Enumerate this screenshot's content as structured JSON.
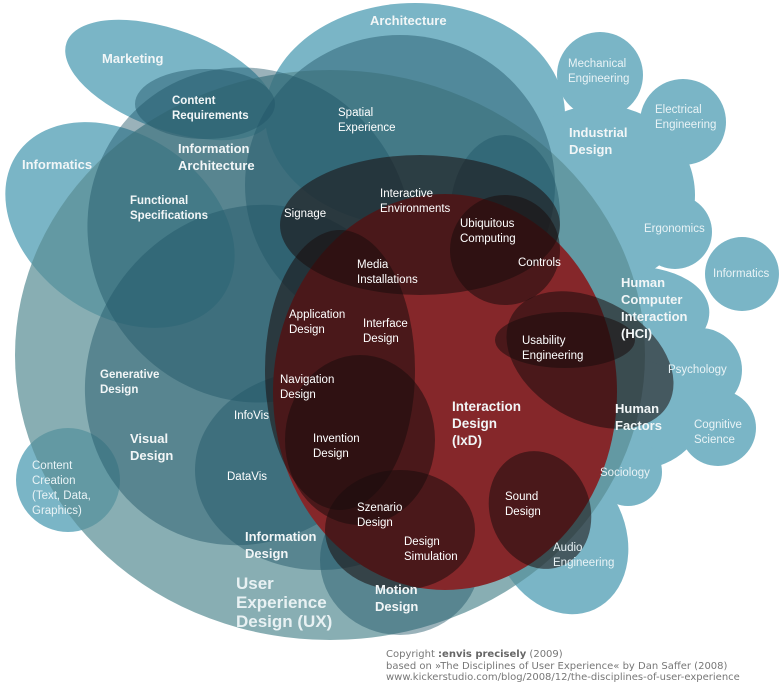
{
  "title": "The Disciplines of User Experience",
  "colors": {
    "light_teal": "#7ab5c6",
    "mid_teal": "#3f7f8e",
    "dark_teal": "#1f5566",
    "ux_gray_teal": "#8fb2b3",
    "ixd_red": "#85272a",
    "dark_overlap": "#2a1517",
    "text_white": "#ffffff",
    "credit_gray": "#777777"
  },
  "labels": {
    "marketing": "Marketing",
    "architecture": "Architecture",
    "informatics_left": "Informatics",
    "content_requirements": "Content\nRequirements",
    "information_architecture": "Information\nArchitecture",
    "spatial_experience": "Spatial\nExperience",
    "functional_specifications": "Functional\nSpecifications",
    "signage": "Signage",
    "interactive_environments": "Interactive\nEnvironments",
    "ubiquitous_computing": "Ubiquitous\nComputing",
    "controls": "Controls",
    "media_installations": "Media\nInstallations",
    "application_design": "Application\nDesign",
    "interface_design": "Interface\nDesign",
    "usability_engineering": "Usability\nEngineering",
    "generative_design": "Generative\nDesign",
    "navigation_design": "Navigation\nDesign",
    "infovis": "InfoVis",
    "visual_design": "Visual\nDesign",
    "invention_design": "Invention\nDesign",
    "interaction_design": "Interaction\nDesign\n(IxD)",
    "datavis": "DataVis",
    "content_creation": "Content\nCreation\n(Text, Data,\nGraphics)",
    "szenario_design": "Szenario\nDesign",
    "sound_design": "Sound\nDesign",
    "information_design": "Information\nDesign",
    "design_simulation": "Design\nSimulation",
    "audio_engineering": "Audio\nEngineering",
    "user_experience_design": "User\nExperience\nDesign (UX)",
    "motion_design": "Motion\nDesign",
    "mechanical_engineering": "Mechanical\nEngineering",
    "electrical_engineering": "Electrical\nEngineering",
    "industrial_design": "Industrial\nDesign",
    "ergonomics": "Ergonomics",
    "informatics_right": "Informatics",
    "hci": "Human\nComputer\nInteraction\n(HCI)",
    "psychology": "Psychology",
    "human_factors": "Human\nFactors",
    "cognitive_science": "Cognitive\nScience",
    "sociology": "Sociology"
  },
  "credits": {
    "copyright_prefix": "Copyright ",
    "copyright_org": ":envis precisely",
    "copyright_year": " (2009)",
    "based_on": "based on »The Disciplines of User Experience« by Dan Saffer (2008)",
    "url": "www.kickerstudio.com/blog/2008/12/the-disciplines-of-user-experience"
  }
}
